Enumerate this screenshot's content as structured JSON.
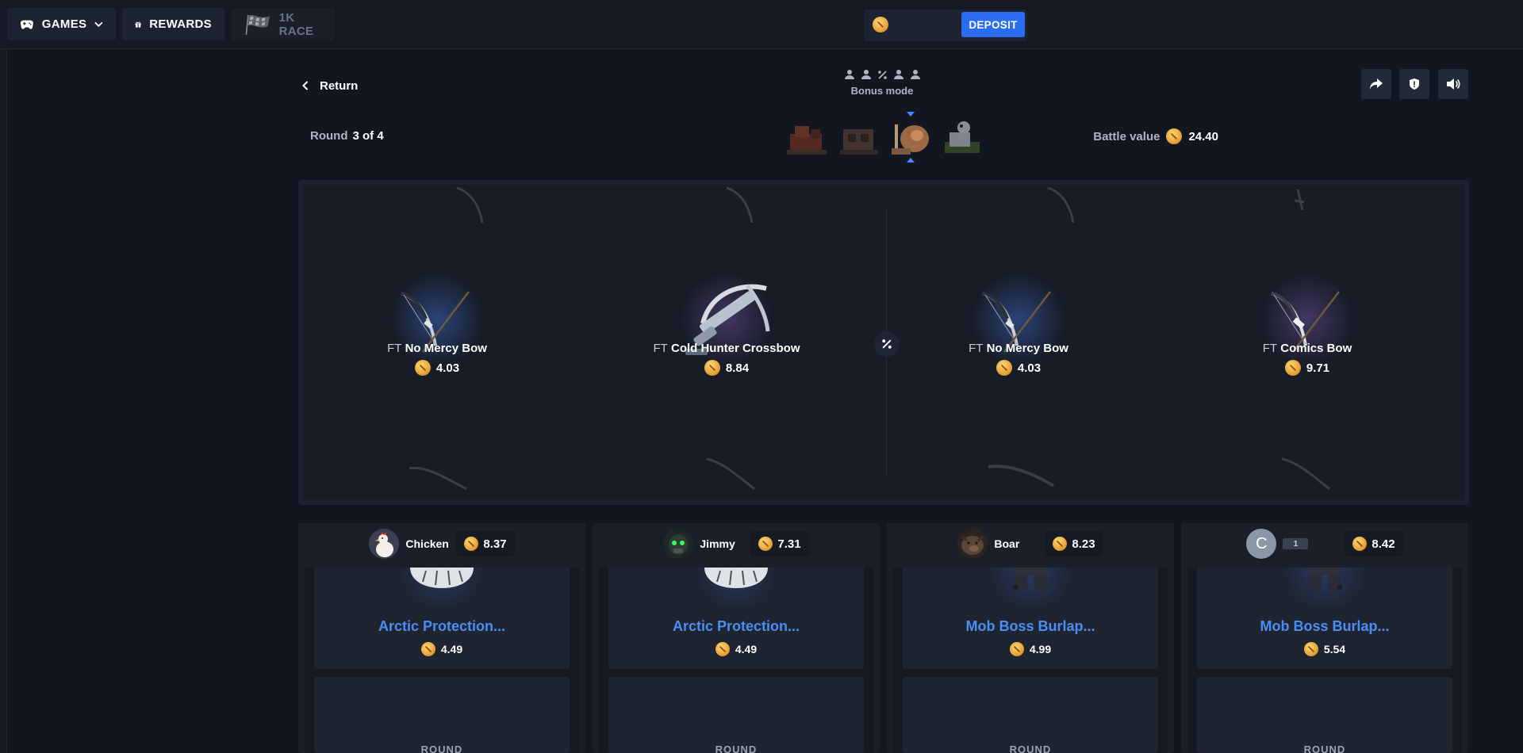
{
  "nav": {
    "games_label": "GAMES",
    "rewards_label": "REWARDS",
    "race_label": "1K RACE"
  },
  "balance": {
    "deposit_label": "DEPOSIT"
  },
  "battle": {
    "return_label": "Return",
    "mode_label": "Bonus mode",
    "round_label": "Round",
    "round_value": "3 of 4",
    "battle_value_label": "Battle value",
    "battle_value": "24.40"
  },
  "reel_slots": [
    {
      "quality": "FT",
      "name": "No Mercy Bow",
      "price": "4.03"
    },
    {
      "quality": "FT",
      "name": "Cold Hunter Crossbow",
      "price": "8.84"
    },
    {
      "quality": "FT",
      "name": "No Mercy Bow",
      "price": "4.03"
    },
    {
      "quality": "FT",
      "name": "Comics Bow",
      "price": "9.71"
    }
  ],
  "players": [
    {
      "name": "Chicken",
      "total": "8.37",
      "item_name": "Arctic Protection...",
      "item_price": "4.49",
      "next_label": "ROUND"
    },
    {
      "name": "Jimmy",
      "total": "7.31",
      "item_name": "Arctic Protection...",
      "item_price": "4.49",
      "next_label": "ROUND"
    },
    {
      "name": "Boar",
      "total": "8.23",
      "item_name": "Mob Boss Burlap...",
      "item_price": "4.99",
      "next_label": "ROUND"
    },
    {
      "name": "",
      "avatar_letter": "C",
      "level": "1",
      "total": "8.42",
      "item_name": "Mob Boss Burlap...",
      "item_price": "5.54",
      "next_label": "ROUND"
    }
  ],
  "colors": {
    "accent": "#2c6cf0",
    "item_name": "#4a8df5",
    "coin": "#e8a33a",
    "background": "#121620"
  }
}
